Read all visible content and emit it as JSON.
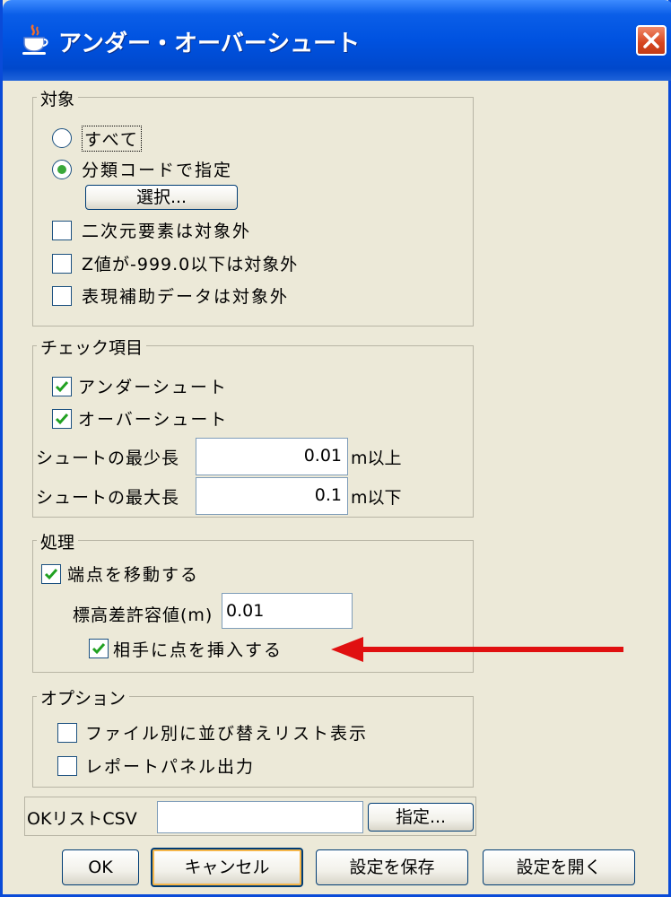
{
  "window": {
    "title": "アンダー・オーバーシュート",
    "app_icon": "java-cup-icon",
    "close_icon": "close-icon"
  },
  "target": {
    "legend": "対象",
    "radio_all": {
      "label": "すべて",
      "selected": false
    },
    "radio_code": {
      "label": "分類コードで指定",
      "selected": true
    },
    "select_button": "選択...",
    "exclude_2d": {
      "label": "二次元要素は対象外",
      "checked": false
    },
    "exclude_z": {
      "label": "Z値が-999.0以下は対象外",
      "checked": false
    },
    "exclude_aux": {
      "label": "表現補助データは対象外",
      "checked": false
    }
  },
  "check_items": {
    "legend": "チェック項目",
    "undershoot": {
      "label": "アンダーシュート",
      "checked": true
    },
    "overshoot": {
      "label": "オーバーシュート",
      "checked": true
    },
    "min_len_label": "シュートの最少長",
    "min_len_value": "0.01",
    "min_len_unit": "m以上",
    "max_len_label": "シュートの最大長",
    "max_len_value": "0.1",
    "max_len_unit": "m以下"
  },
  "process": {
    "legend": "処理",
    "move_endpoint": {
      "label": "端点を移動する",
      "checked": true
    },
    "tolerance_label": "標高差許容値(m)",
    "tolerance_value": "0.01",
    "insert_point": {
      "label": "相手に点を挿入する",
      "checked": true
    }
  },
  "options": {
    "legend": "オプション",
    "sort_list": {
      "label": "ファイル別に並び替えリスト表示",
      "checked": false
    },
    "report_panel": {
      "label": "レポートパネル出力",
      "checked": false
    }
  },
  "ok_list": {
    "label": "OKリストCSV",
    "value": "",
    "specify_button": "指定..."
  },
  "buttons": {
    "ok": "OK",
    "cancel": "キャンセル",
    "save_settings": "設定を保存",
    "open_settings": "設定を開く"
  },
  "annotation": {
    "arrow_color": "#e01010"
  }
}
